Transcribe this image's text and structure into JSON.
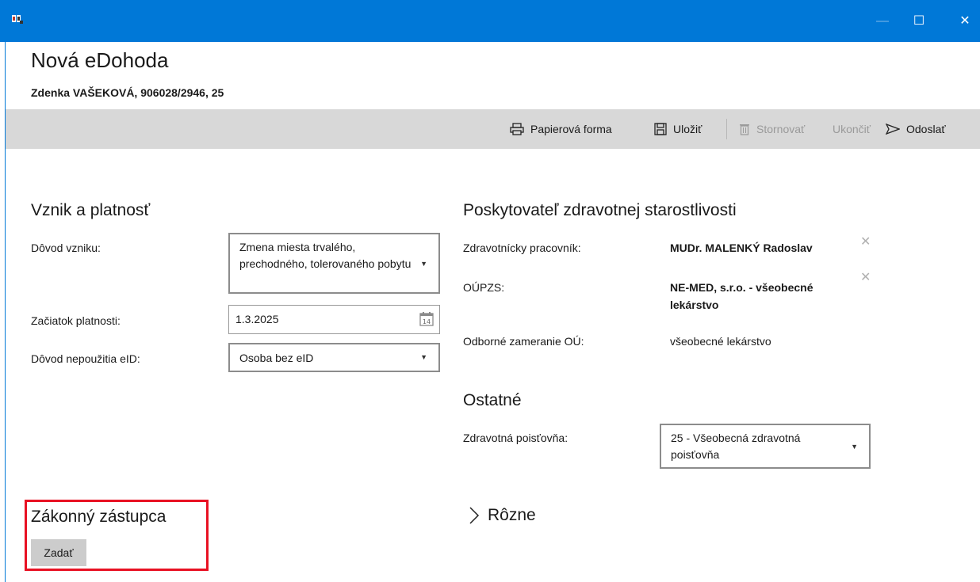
{
  "window": {
    "app_icon": "app-logo-icon",
    "minimize": "—",
    "maximize": "☐",
    "close": "✕"
  },
  "page": {
    "title": "Nová eDohoda",
    "patient": "Zdenka VAŠEKOVÁ, 906028/2946, 25"
  },
  "toolbar": {
    "paper_form": "Papierová forma",
    "save": "Uložiť",
    "cancel": "Stornovať",
    "end": "Ukončiť",
    "send": "Odoslať"
  },
  "vznik": {
    "title": "Vznik a platnosť",
    "reason_label": "Dôvod vzniku:",
    "reason_value": "Zmena miesta trvalého, prechodného, tolerovaného pobytu",
    "start_label": "Začiatok platnosti:",
    "start_value": "1.3.2025",
    "eid_label": "Dôvod nepoužitia eID:",
    "eid_value": "Osoba bez eID"
  },
  "provider": {
    "title": "Poskytovateľ zdravotnej starostlivosti",
    "worker_label": "Zdravotnícky pracovník:",
    "worker_value": "MUDr. MALENKÝ Radoslav",
    "oupzs_label": "OÚPZS:",
    "oupzs_value": "NE-MED, s.r.o. - všeobecné lekárstvo",
    "focus_label": "Odborné zameranie OÚ:",
    "focus_value": "všeobecné lekárstvo"
  },
  "other": {
    "title": "Ostatné",
    "insurance_label": "Zdravotná poisťovňa:",
    "insurance_value": "25 - Všeobecná zdravotná poisťovňa"
  },
  "misc": {
    "title": "Rôzne"
  },
  "legal": {
    "title": "Zákonný zástupca",
    "button": "Zadať"
  },
  "colors": {
    "titlebar": "#0078d7",
    "toolbar": "#d8d8d8",
    "highlight": "#e81123"
  }
}
